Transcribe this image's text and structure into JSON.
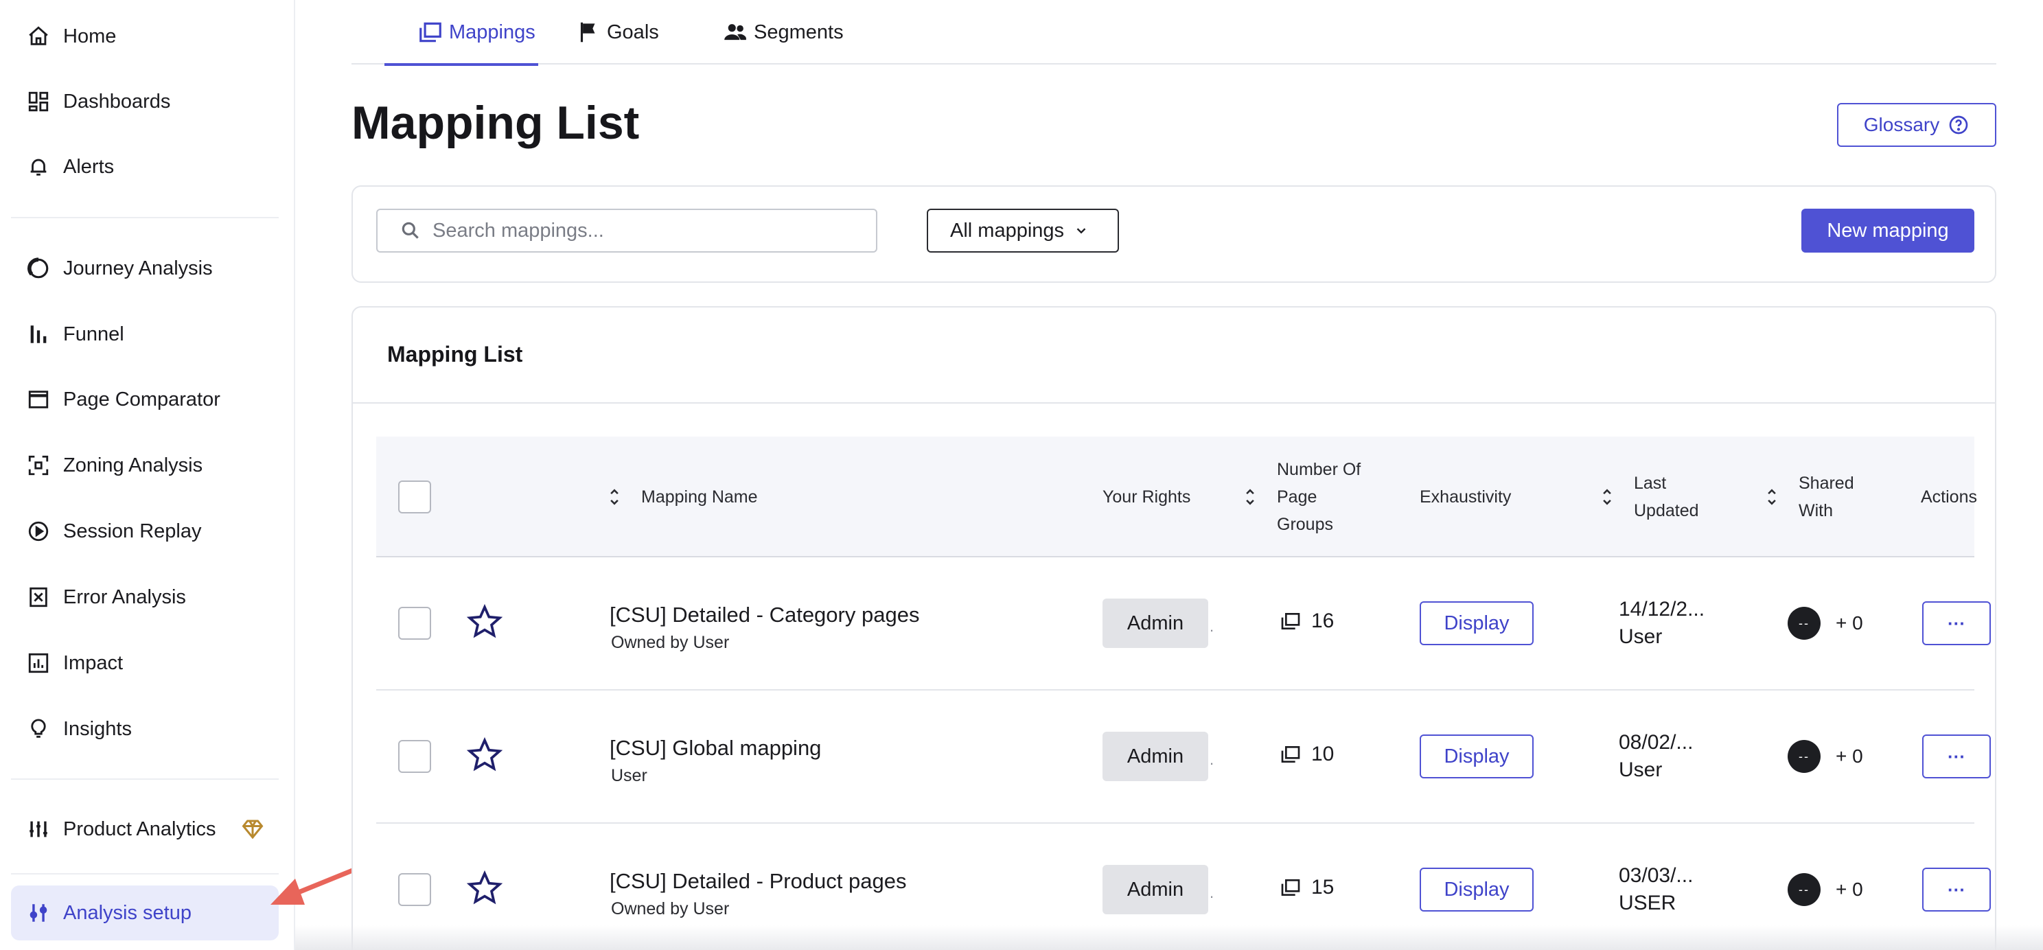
{
  "sidebar": {
    "items": [
      {
        "label": "Home",
        "icon": "home-icon"
      },
      {
        "label": "Dashboards",
        "icon": "dashboard-icon"
      },
      {
        "label": "Alerts",
        "icon": "bell-icon"
      },
      {
        "label": "Journey Analysis",
        "icon": "journey-icon"
      },
      {
        "label": "Funnel",
        "icon": "funnel-icon"
      },
      {
        "label": "Page Comparator",
        "icon": "window-icon"
      },
      {
        "label": "Zoning Analysis",
        "icon": "zoning-icon"
      },
      {
        "label": "Session Replay",
        "icon": "play-icon"
      },
      {
        "label": "Error Analysis",
        "icon": "error-icon"
      },
      {
        "label": "Impact",
        "icon": "impact-icon"
      },
      {
        "label": "Insights",
        "icon": "lightbulb-icon"
      },
      {
        "label": "Product Analytics",
        "icon": "product-analytics-icon"
      },
      {
        "label": "Analysis setup",
        "icon": "sliders-icon"
      }
    ]
  },
  "tabs": [
    {
      "label": "Mappings",
      "icon": "mappings-icon",
      "active": true
    },
    {
      "label": "Goals",
      "icon": "flag-icon",
      "active": false
    },
    {
      "label": "Segments",
      "icon": "people-icon",
      "active": false
    }
  ],
  "header": {
    "title": "Mapping List",
    "glossary_label": "Glossary"
  },
  "filters": {
    "search_placeholder": "Search mappings...",
    "select_value": "All mappings",
    "new_button_label": "New mapping"
  },
  "table": {
    "title": "Mapping List",
    "columns": {
      "name": "Mapping Name",
      "rights": "Your Rights",
      "groups_line1": "Number Of",
      "groups_line2": "Page",
      "groups_line3": "Groups",
      "exhaustivity": "Exhaustivity",
      "updated_line1": "Last",
      "updated_line2": "Updated",
      "shared_line1": "Shared",
      "shared_line2": "With",
      "actions": "Actions"
    },
    "rows": [
      {
        "name": "[CSU] Detailed - Category pages",
        "owner": "Owned by User",
        "rights": "Admin",
        "groups": "16",
        "exhaustivity": "Display",
        "date": "14/12/2...",
        "updated_by": "User",
        "avatar": "--",
        "shared": "+ 0",
        "actions": "···"
      },
      {
        "name": "[CSU] Global mapping",
        "owner": "User",
        "rights": "Admin",
        "groups": "10",
        "exhaustivity": "Display",
        "date": "08/02/...",
        "updated_by": "User",
        "avatar": "--",
        "shared": "+ 0",
        "actions": "···"
      },
      {
        "name": "[CSU] Detailed - Product pages",
        "owner": "Owned by User",
        "rights": "Admin",
        "groups": "15",
        "exhaustivity": "Display",
        "date": "03/03/...",
        "updated_by": "USER",
        "avatar": "--",
        "shared": "+ 0",
        "actions": "···"
      }
    ]
  },
  "colors": {
    "accent": "#4f52d4",
    "active_nav_bg": "#e9ebfb",
    "annotation_arrow": "#e8655a",
    "gem": "#b8892e"
  }
}
